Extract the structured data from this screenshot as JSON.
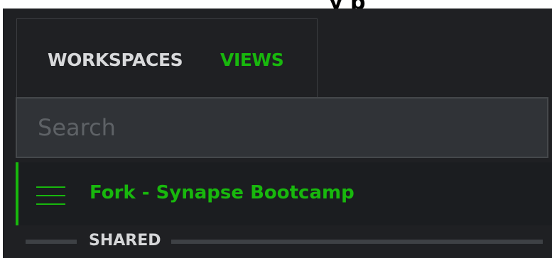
{
  "page": {
    "title_fragment": "y      p"
  },
  "tabs": [
    {
      "label": "WORKSPACES",
      "active": false
    },
    {
      "label": "VIEWS",
      "active": true
    }
  ],
  "search": {
    "value": "",
    "placeholder": "Search"
  },
  "view_item": {
    "label": "Fork - Synapse Bootcamp",
    "icon": "menu-icon",
    "selected": true
  },
  "section": {
    "label": "SHARED"
  },
  "colors": {
    "accent": "#18b80d",
    "panel_background": "#1f2023",
    "search_background": "#303337",
    "text_light": "#d8d9db",
    "divider": "#3e4145"
  }
}
